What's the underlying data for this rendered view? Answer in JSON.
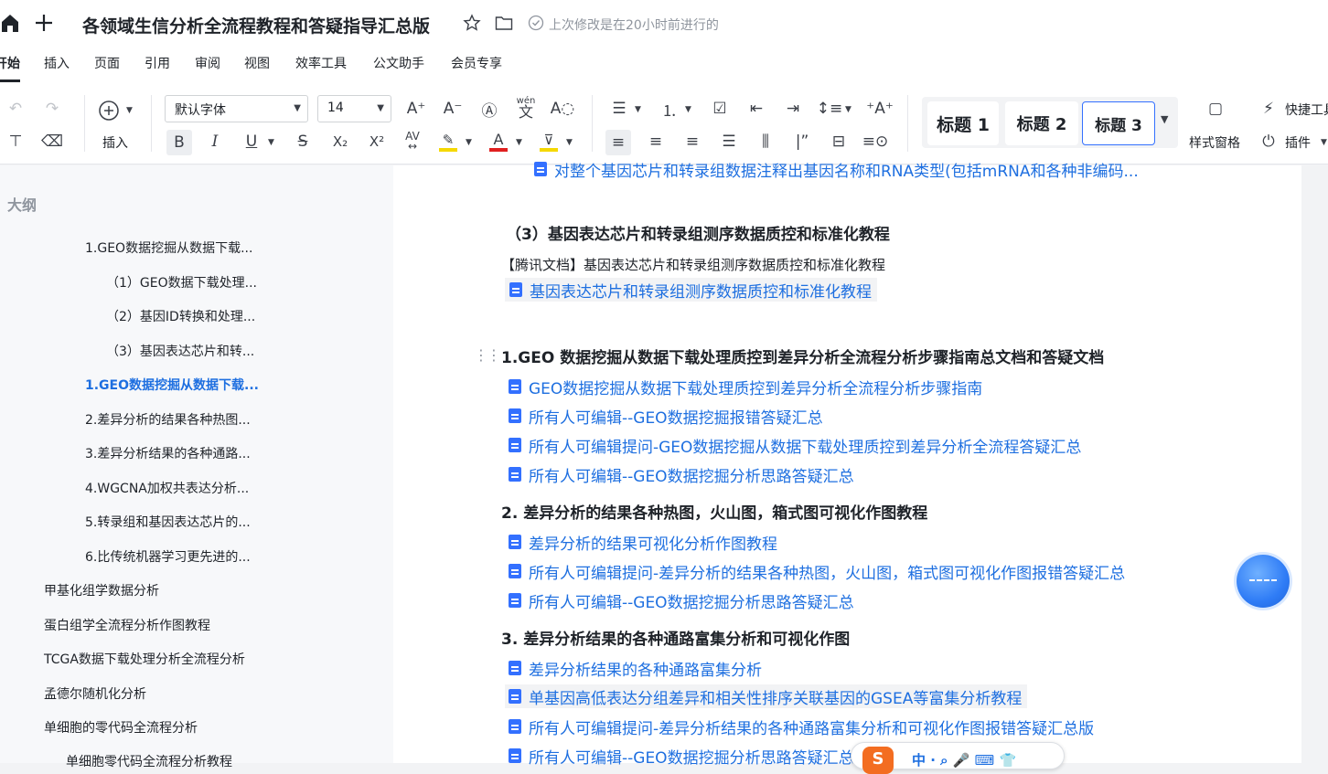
{
  "titlebar": {
    "title": "各领域生信分析全流程教程和答疑指导汇总版",
    "status": "上次修改是在20小时前进行的",
    "icons": [
      "home-icon",
      "plus-icon",
      "star-icon",
      "folder-icon",
      "check-circle-icon"
    ]
  },
  "menu": {
    "items": [
      "开始",
      "插入",
      "页面",
      "引用",
      "审阅",
      "视图",
      "效率工具",
      "公文助手",
      "会员专享"
    ],
    "active": "开始"
  },
  "toolbar": {
    "insert_label": "插入",
    "font_family": "默认字体",
    "font_size": "14",
    "headings": [
      "标题 1",
      "标题 2",
      "标题 3"
    ],
    "style_pane_label": "样式窗格",
    "quick_tools_label": "快捷工具",
    "plugins_label": "插件",
    "phonetic_label": "wén",
    "highlight_color": "#f5d800",
    "font_color": "#e02020"
  },
  "outline": {
    "title": "大纲",
    "items": [
      "1.GEO数据挖掘从数据下载...",
      "（1）GEO数据下载处理...",
      "（2）基因ID转换和处理...",
      "（3）基因表达芯片和转...",
      "1.GEO数据挖掘从数据下载...",
      "2.差异分析的结果各种热图...",
      "3.差异分析结果的各种通路...",
      "4.WGCNA加权共表达分析...",
      "5.转录组和基因表达芯片的...",
      "6.比传统机器学习更先进的...",
      "甲基化组学数据分析",
      "蛋白组学全流程分析作图教程",
      "TCGA数据下载处理分析全流程分析",
      "孟德尔随机化分析",
      "单细胞的零代码全流程分析",
      "单细胞零代码全流程分析教程"
    ]
  },
  "content": {
    "top_cut_link": "对整个基因芯片和转录组数据注释出基因名称和RNA类型(包括mRNA和各种非编码...",
    "section3_title": "（3）基因表达芯片和转录组测序数据质控和标准化教程",
    "section3_plain": "【腾讯文档】基因表达芯片和转录组测序数据质控和标准化教程",
    "section3_link": "基因表达芯片和转录组测序数据质控和标准化教程",
    "h1": "1.GEO 数据挖掘从数据下载处理质控到差异分析全流程分析步骤指南总文档和答疑文档",
    "h1_links": [
      "GEO数据挖掘从数据下载处理质控到差异分析全流程分析步骤指南",
      "所有人可编辑--GEO数据挖掘报错答疑汇总",
      "所有人可编辑提问-GEO数据挖掘从数据下载处理质控到差异分析全流程答疑汇总",
      "所有人可编辑--GEO数据挖掘分析思路答疑汇总"
    ],
    "h2": "2.  差异分析的结果各种热图，火山图，箱式图可视化作图教程",
    "h2_links": [
      "差异分析的结果可视化分析作图教程",
      "所有人可编辑提问-差异分析的结果各种热图，火山图，箱式图可视化作图报错答疑汇总",
      "所有人可编辑--GEO数据挖掘分析思路答疑汇总"
    ],
    "h3": "3.  差异分析结果的各种通路富集分析和可视化作图",
    "h3_links": [
      "差异分析结果的各种通路富集分析",
      "单基因高低表达分组差异和相关性排序关联基因的GSEA等富集分析教程",
      "所有人可编辑提问-差异分析结果的各种通路富集分析和可视化作图报错答疑汇总版",
      "所有人可编辑--GEO数据挖掘分析思路答疑汇总"
    ]
  },
  "ime": {
    "logo": "S",
    "text": "中 · ⌕ 🎤 ⌨ 👕"
  }
}
